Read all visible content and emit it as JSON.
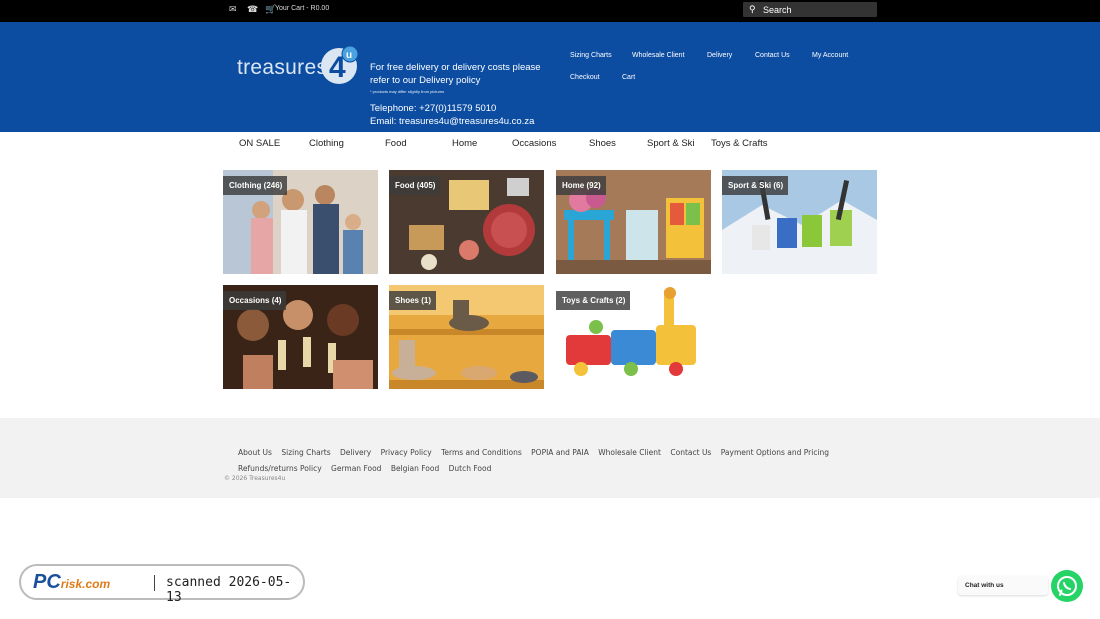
{
  "topbar": {
    "mail_icon": "envelope-icon",
    "phone_icon": "phone-icon",
    "cart_icon": "cart-icon",
    "cart_text": "Your Cart - R0.00",
    "search_placeholder": "Search"
  },
  "header": {
    "logo_text": "treasures",
    "logo_mark": "4u",
    "promo": "For free delivery or delivery costs please refer to our Delivery policy",
    "disclaimer": "* products may differ slightly from pictures",
    "telephone": "Telephone: +27(0)11579 5010",
    "email": "Email: treasures4u@treasures4u.co.za",
    "nav": [
      "Sizing Charts",
      "Wholesale Client",
      "Delivery",
      "Contact Us",
      "My Account",
      "Checkout",
      "Cart"
    ]
  },
  "categories": [
    "ON SALE",
    "Clothing",
    "Food",
    "Home",
    "Occasions",
    "Shoes",
    "Sport & Ski",
    "Toys & Crafts"
  ],
  "tiles": [
    {
      "label": "Clothing (246)"
    },
    {
      "label": "Food (405)"
    },
    {
      "label": "Home (92)"
    },
    {
      "label": "Sport & Ski (6)"
    },
    {
      "label": "Occasions (4)"
    },
    {
      "label": "Shoes (1)"
    },
    {
      "label": "Toys & Crafts (2)"
    }
  ],
  "footer": {
    "links": [
      "About Us",
      "Sizing Charts",
      "Delivery",
      "Privacy Policy",
      "Terms and Conditions",
      "POPIA and PAIA",
      "Wholesale Client",
      "Contact Us",
      "Payment Options and Pricing",
      "Refunds/returns Policy",
      "German Food",
      "Belgian Food",
      "Dutch Food"
    ],
    "copyright": "© 2026 Treasures4u"
  },
  "overlay": {
    "brand": "PC",
    "brand_suffix": "risk.com",
    "scanned": "scanned 2026-05-13",
    "chat_label": "Chat with us",
    "chat_icon": "whatsapp-icon"
  }
}
